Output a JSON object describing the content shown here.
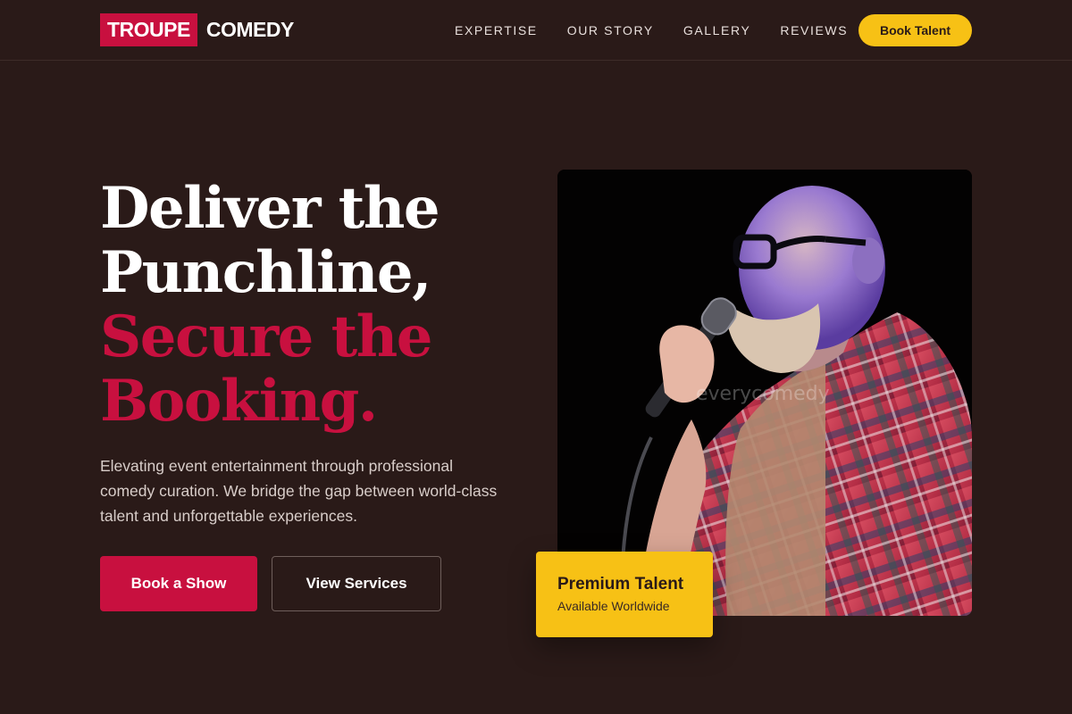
{
  "brand": {
    "part1": "TROUPE",
    "part2": "COMEDY"
  },
  "nav": {
    "links": [
      "EXPERTISE",
      "OUR STORY",
      "GALLERY",
      "REVIEWS"
    ],
    "cta": "Book Talent"
  },
  "hero": {
    "line1": "Deliver the",
    "line2": "Punchline,",
    "line3": "Secure the",
    "line4": "Booking.",
    "lead": "Elevating event entertainment through professional comedy curation. We bridge the gap between world-class talent and unforgettable experiences.",
    "primary_button": "Book a Show",
    "secondary_button": "View Services"
  },
  "photo": {
    "watermark": "everycomedy"
  },
  "badge": {
    "title": "Premium Talent",
    "subtitle": "Available Worldwide"
  },
  "colors": {
    "background": "#2a1a18",
    "accent": "#c8103f",
    "yellow": "#f7c115"
  }
}
